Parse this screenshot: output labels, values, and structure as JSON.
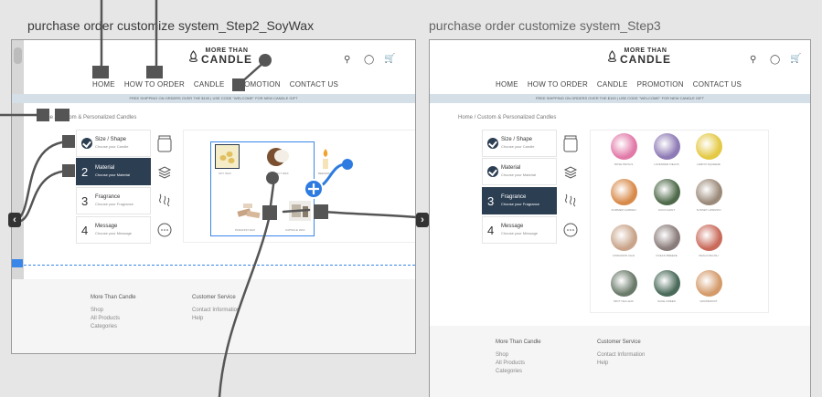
{
  "frames": [
    {
      "title": "purchase order customize system_Step2_SoyWax",
      "logo": {
        "line1": "MORE THAN",
        "line2": "CANDLE"
      },
      "nav": [
        "HOME",
        "HOW TO ORDER",
        "CANDLE",
        "PROMOTION",
        "CONTACT US"
      ],
      "banner": "FREE SHIPPING ON ORDERS OVER THE $100 | USE CODE \"WELCOME\" FOR NEW CANDLE GIFT",
      "breadcrumb": "Home / Custom & Personalized Candles",
      "steps": [
        {
          "num": "",
          "title": "Size / Shape",
          "sub": "Choose your Candle",
          "done": true
        },
        {
          "num": "2",
          "title": "Material",
          "sub": "Choose your Material",
          "active": true
        },
        {
          "num": "3",
          "title": "Fragrance",
          "sub": "Choose your Fragrance"
        },
        {
          "num": "4",
          "title": "Message",
          "sub": "Choose your Message"
        }
      ],
      "materials": [
        "SOY WAX",
        "COCONUT WAX",
        "BEESWAX",
        "PARAFFIN WAX",
        "CAPSULE WAX"
      ],
      "footer": {
        "col1": {
          "title": "More Than Candle",
          "items": [
            "Shop",
            "All Products",
            "Categories"
          ]
        },
        "col2": {
          "title": "Customer Service",
          "items": [
            "Contact Information",
            "Help"
          ]
        }
      }
    },
    {
      "title": "purchase order customize system_Step3",
      "logo": {
        "line1": "MORE THAN",
        "line2": "CANDLE"
      },
      "nav": [
        "HOME",
        "HOW TO ORDER",
        "CANDLE",
        "PROMOTION",
        "CONTACT US"
      ],
      "banner": "FREE SHIPPING ON ORDERS OVER THE $100 | USE CODE \"WELCOME\" FOR NEW CANDLE GIFT",
      "breadcrumb": "Home / Custom & Personalized Candles",
      "steps": [
        {
          "num": "",
          "title": "Size / Shape",
          "sub": "Choose your Candle",
          "done": true
        },
        {
          "num": "",
          "title": "Material",
          "sub": "Choose your Material",
          "done": true
        },
        {
          "num": "3",
          "title": "Fragrance",
          "sub": "Choose your Fragrance",
          "active": true
        },
        {
          "num": "4",
          "title": "Message",
          "sub": "Choose your Message"
        }
      ],
      "fragrances": [
        {
          "label": "ROSE PETALS",
          "color": "#e27aa8"
        },
        {
          "label": "LAVENDER FIELDS",
          "color": "#8e7ab5"
        },
        {
          "label": "LEMON SQUEEZE",
          "color": "#e4c945"
        },
        {
          "label": "SUMMER GARDEN",
          "color": "#d88a4a"
        },
        {
          "label": "SUCCULENT",
          "color": "#4f6a4a"
        },
        {
          "label": "SUNSET HORIZON",
          "color": "#9b8a7a"
        },
        {
          "label": "CINNAMON CHAI",
          "color": "#c9a48a"
        },
        {
          "label": "OCEAN BREEZE",
          "color": "#8a7c7a"
        },
        {
          "label": "PEACH BLUSH",
          "color": "#c96a5a"
        },
        {
          "label": "MINT TEA LEAF",
          "color": "#6a7a6a"
        },
        {
          "label": "SAGE GREEN",
          "color": "#4a6a5a"
        },
        {
          "label": "GRAPEFRUIT",
          "color": "#d49a6a"
        }
      ],
      "footer": {
        "col1": {
          "title": "More Than Candle",
          "items": [
            "Shop",
            "All Products",
            "Categories"
          ]
        },
        "col2": {
          "title": "Customer Service",
          "items": [
            "Contact Information",
            "Help"
          ]
        }
      }
    }
  ],
  "icons": {
    "search": "search-icon",
    "account": "account-icon",
    "cart": "cart-icon",
    "prev": "chevron-left-icon",
    "next": "chevron-right-icon",
    "add": "plus-icon"
  },
  "colors": {
    "accent": "#3a86e8",
    "dark": "#2c3e52",
    "connector": "#555555"
  }
}
